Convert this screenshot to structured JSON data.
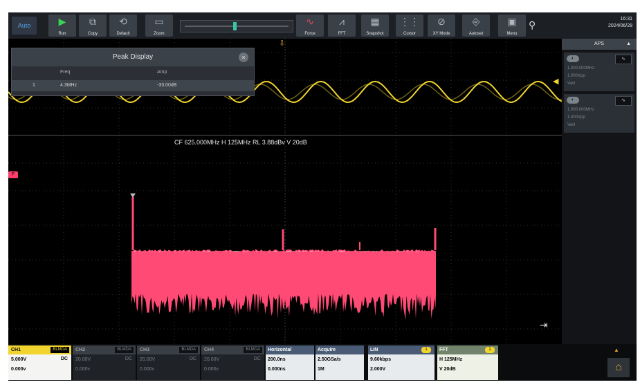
{
  "toolbar": {
    "auto_label": "Auto",
    "buttons": [
      {
        "label": "Run",
        "icon": "play-icon"
      },
      {
        "label": "Copy",
        "icon": "copy-icon"
      },
      {
        "label": "Default",
        "icon": "default-icon"
      },
      {
        "label": "Zoom",
        "icon": "zoom-icon"
      },
      {
        "label": "Force",
        "icon": "force-icon"
      },
      {
        "label": "FFT",
        "icon": "fft-icon"
      },
      {
        "label": "Snapshot",
        "icon": "snapshot-icon"
      },
      {
        "label": "Cursor",
        "icon": "cursor-icon"
      },
      {
        "label": "XY Mode",
        "icon": "xy-mode-icon"
      },
      {
        "label": "Autoset",
        "icon": "autoset-icon"
      },
      {
        "label": "Menu",
        "icon": "menu-icon"
      }
    ],
    "time": "16:31",
    "date": "2024/06/28"
  },
  "peak_display": {
    "title": "Peak Display",
    "close": "×",
    "columns": [
      "Freq",
      "Amp"
    ],
    "rows": [
      {
        "index": "1",
        "freq": "4.3MHz",
        "amp": "-33.00dB"
      }
    ]
  },
  "fft_info": "CF 625.000MHz   H 125MHz   RL 3.88dBv   V 20dB",
  "right_panel": {
    "title": "APS",
    "cards": [
      {
        "lines": [
          "1.000.000MHz",
          "1.000Vpp",
          "Vavl"
        ]
      },
      {
        "lines": [
          "1.000.000MHz",
          "1.000Vpp",
          "Vavl"
        ]
      }
    ]
  },
  "bottom": {
    "channels": [
      {
        "name": "CH1",
        "bw": "BLMDA",
        "scale": "5.000V",
        "offset": "0.000v",
        "mode": "DC"
      },
      {
        "name": "CH2",
        "bw": "BLMDA",
        "scale": "20.00V",
        "offset": "0.000v",
        "mode": "DC"
      },
      {
        "name": "CH3",
        "bw": "BLMDA",
        "scale": "20.00V",
        "offset": "0.000v",
        "mode": "DC"
      },
      {
        "name": "CH4",
        "bw": "BLMDA",
        "scale": "20.00V",
        "offset": "0.000v",
        "mode": "DC"
      }
    ],
    "horizontal": {
      "title": "Horizontal",
      "line1": "200.0ns",
      "line2": "0.000ns"
    },
    "acquire": {
      "title": "Acquire",
      "line1": "2.50GSa/s",
      "line2": "1M"
    },
    "trigger": {
      "title": "LIN",
      "badge": "1",
      "line1": "9.60kbps",
      "line2": "2.000V"
    },
    "fft": {
      "title": "FFT",
      "badge": "1",
      "line1": "H 125MHz",
      "line2": "V 20dB"
    }
  },
  "colors": {
    "ch1": "#f1d52e",
    "fft": "#ff4a75",
    "accent": "#e2a32b"
  }
}
